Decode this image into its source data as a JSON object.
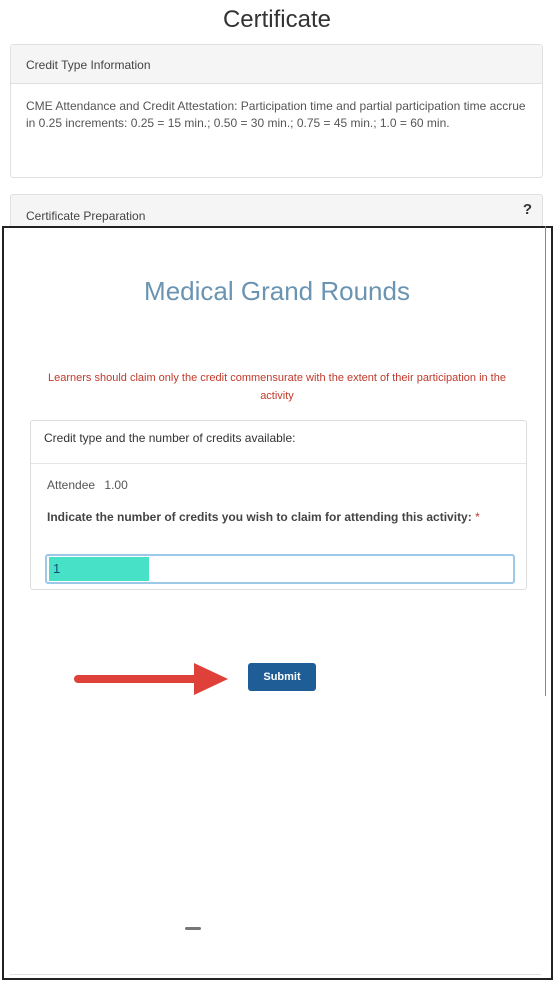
{
  "page": {
    "title": "Certificate"
  },
  "credit_type_panel": {
    "heading": "Credit Type Information",
    "body": "CME Attendance and Credit Attestation: Participation time and partial participation time accrue in 0.25 increments: 0.25 = 15 min.; 0.50 = 30 min.; 0.75 = 45 min.; 1.0 = 60 min."
  },
  "certificate_panel": {
    "heading": "Certificate Preparation",
    "help_symbol": "?"
  },
  "form": {
    "event_title": "Medical Grand Rounds",
    "warning": "Learners should claim only the credit commensurate with the extent of their participation in the activity",
    "credit_heading": "Credit type and the number of credits available:",
    "attendee_label": "Attendee",
    "attendee_credits": "1.00",
    "claim_label": "Indicate the number of credits you wish to claim for attending this activity:",
    "required_marker": "*",
    "claim_value": "1",
    "submit_label": "Submit"
  },
  "colors": {
    "title_blue": "#6a94b2",
    "warning_red": "#c0392b",
    "submit_blue": "#1e5d96",
    "highlight_teal": "#47e1c8",
    "arrow_red": "#e0403a"
  }
}
